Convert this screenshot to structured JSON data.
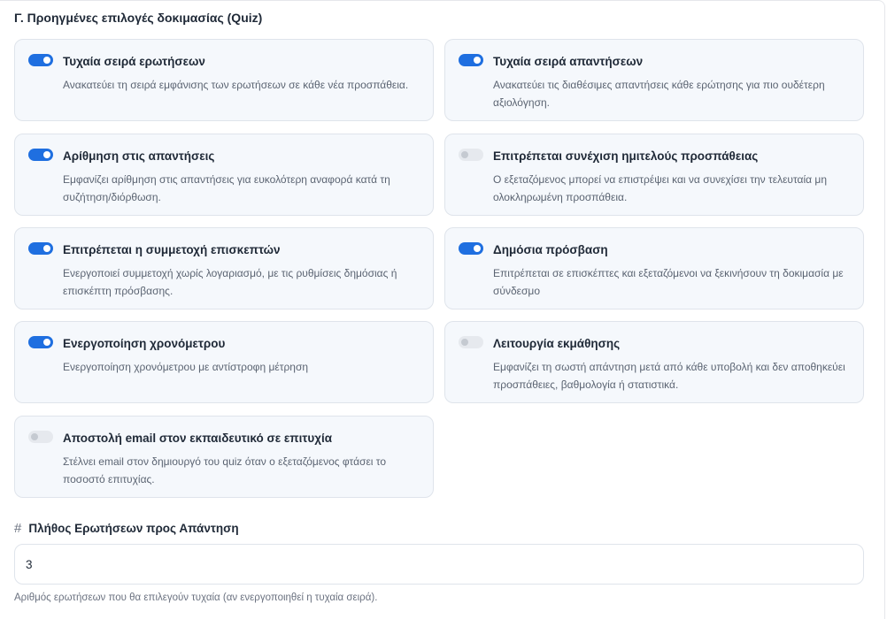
{
  "section": {
    "title": "Γ. Προηγμένες επιλογές δοκιμασίας (Quiz)"
  },
  "options": [
    {
      "title": "Τυχαία σειρά ερωτήσεων",
      "description": "Ανακατεύει τη σειρά εμφάνισης των ερωτήσεων σε κάθε νέα προσπάθεια.",
      "enabled": true
    },
    {
      "title": "Τυχαία σειρά απαντήσεων",
      "description": "Ανακατεύει τις διαθέσιμες απαντήσεις κάθε ερώτησης για πιο ουδέτερη αξιολόγηση.",
      "enabled": true
    },
    {
      "title": "Αρίθμηση στις απαντήσεις",
      "description": "Εμφανίζει αρίθμηση στις απαντήσεις για ευκολότερη αναφορά κατά τη συζήτηση/διόρθωση.",
      "enabled": true
    },
    {
      "title": "Επιτρέπεται συνέχιση ημιτελούς προσπάθειας",
      "description": "Ο εξεταζόμενος μπορεί να επιστρέψει και να συνεχίσει την τελευταία μη ολοκληρωμένη προσπάθεια.",
      "enabled": false
    },
    {
      "title": "Επιτρέπεται η συμμετοχή επισκεπτών",
      "description": "Ενεργοποιεί συμμετοχή χωρίς λογαριασμό, με τις ρυθμίσεις δημόσιας ή επισκέπτη πρόσβασης.",
      "enabled": true
    },
    {
      "title": "Δημόσια πρόσβαση",
      "description": "Επιτρέπεται σε επισκέπτες και εξεταζόμενοι να ξεκινήσουν τη δοκιμασία με σύνδεσμο",
      "enabled": true
    },
    {
      "title": "Ενεργοποίηση χρονόμετρου",
      "description": "Ενεργοποίηση χρονόμετρου με αντίστροφη μέτρηση",
      "enabled": true
    },
    {
      "title": "Λειτουργία εκμάθησης",
      "description": "Εμφανίζει τη σωστή απάντηση μετά από κάθε υποβολή και δεν αποθηκεύει προσπάθειες, βαθμολογία ή στατιστικά.",
      "enabled": false
    },
    {
      "title": "Αποστολή email στον εκπαιδευτικό σε επιτυχία",
      "description": "Στέλνει email στον δημιουργό του quiz όταν ο εξεταζόμενος φτάσει το ποσοστό επιτυχίας.",
      "enabled": false
    }
  ],
  "questions_count": {
    "icon": "hash-icon",
    "icon_glyph": "#",
    "label": "Πλήθος Ερωτήσεων προς Απάντηση",
    "value": "3",
    "help": "Αριθμός ερωτήσεων που θα επιλεγούν τυχαία (αν ενεργοποιηθεί η τυχαία σειρά)."
  },
  "colors": {
    "toggle_on": "#1f6fe0",
    "toggle_off": "#e6e9ee",
    "card_bg": "#f5f8fc"
  }
}
